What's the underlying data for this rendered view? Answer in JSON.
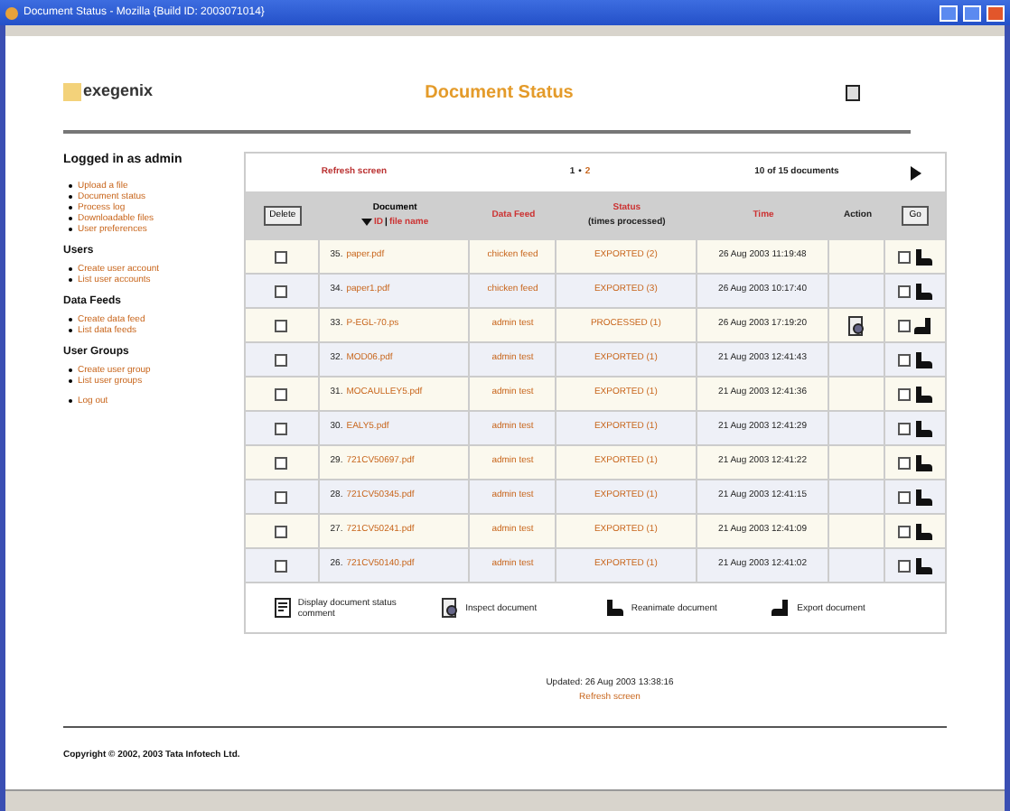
{
  "window": {
    "title": "Document Status - Mozilla {Build ID: 2003071014}"
  },
  "header": {
    "logo": "exegenix",
    "title": "Document Status"
  },
  "sidebar": {
    "heading": "Logged in as admin",
    "sections": [
      {
        "items": [
          "Upload a file",
          "Document status",
          "Process log",
          "Downloadable files",
          "User preferences"
        ]
      },
      {
        "title": "Users",
        "items": [
          "Create user account",
          "List user accounts"
        ]
      },
      {
        "title": "Data Feeds",
        "items": [
          "Create data feed",
          "List data feeds"
        ]
      },
      {
        "title": "User Groups",
        "items": [
          "Create user group",
          "List user groups"
        ]
      },
      {
        "items": [
          "Log out"
        ]
      }
    ]
  },
  "table": {
    "refresh": "Refresh screen",
    "pages": [
      {
        "label": "1",
        "selected": true
      },
      {
        "label": "2",
        "selected": false
      }
    ],
    "page_sep": "•",
    "count": "10 of 15 documents",
    "delete_button": "Delete",
    "go_button": "Go",
    "columns": {
      "document": "Document",
      "sort_id": "ID",
      "sort_sep": "|",
      "sort_file": "file name",
      "feed": "Data Feed",
      "status": "Status",
      "status_sub": "(times processed)",
      "time": "Time",
      "action": "Action"
    },
    "rows": [
      {
        "id": "35.",
        "file": "paper.pdf",
        "feed": "chicken feed",
        "status": "EXPORTED (2)",
        "time": "26 Aug 2003 11:19:48",
        "inspect": false,
        "kind": "reanimate",
        "checked": false,
        "checked2": false
      },
      {
        "id": "34.",
        "file": "paper1.pdf",
        "feed": "chicken feed",
        "status": "EXPORTED (3)",
        "time": "26 Aug 2003 10:17:40",
        "inspect": false,
        "kind": "reanimate",
        "checked": false,
        "checked2": false
      },
      {
        "id": "33.",
        "file": "P-EGL-70.ps",
        "feed": "admin test",
        "status": "PROCESSED (1)",
        "time": "26 Aug 2003 17:19:20",
        "inspect": true,
        "kind": "export",
        "checked": false,
        "checked2": false
      },
      {
        "id": "32.",
        "file": "MOD06.pdf",
        "feed": "admin test",
        "status": "EXPORTED (1)",
        "time": "21 Aug 2003 12:41:43",
        "inspect": false,
        "kind": "reanimate",
        "checked": false,
        "checked2": false
      },
      {
        "id": "31.",
        "file": "MOCAULLEY5.pdf",
        "feed": "admin test",
        "status": "EXPORTED (1)",
        "time": "21 Aug 2003 12:41:36",
        "inspect": false,
        "kind": "reanimate",
        "checked": false,
        "checked2": false
      },
      {
        "id": "30.",
        "file": "EALY5.pdf",
        "feed": "admin test",
        "status": "EXPORTED (1)",
        "time": "21 Aug 2003 12:41:29",
        "inspect": false,
        "kind": "reanimate",
        "checked": false,
        "checked2": false
      },
      {
        "id": "29.",
        "file": "721CV50697.pdf",
        "feed": "admin test",
        "status": "EXPORTED (1)",
        "time": "21 Aug 2003 12:41:22",
        "inspect": false,
        "kind": "reanimate",
        "checked": false,
        "checked2": false
      },
      {
        "id": "28.",
        "file": "721CV50345.pdf",
        "feed": "admin test",
        "status": "EXPORTED (1)",
        "time": "21 Aug 2003 12:41:15",
        "inspect": false,
        "kind": "reanimate",
        "checked": false,
        "checked2": false
      },
      {
        "id": "27.",
        "file": "721CV50241.pdf",
        "feed": "admin test",
        "status": "EXPORTED (1)",
        "time": "21 Aug 2003 12:41:09",
        "inspect": false,
        "kind": "reanimate",
        "checked": false,
        "checked2": false
      },
      {
        "id": "26.",
        "file": "721CV50140.pdf",
        "feed": "admin test",
        "status": "EXPORTED (1)",
        "time": "21 Aug 2003 12:41:02",
        "inspect": false,
        "kind": "reanimate",
        "checked": false,
        "checked2": false
      }
    ],
    "legend": [
      {
        "kind": "comment",
        "label": "Display document status comment"
      },
      {
        "kind": "inspect",
        "label": "Inspect document"
      },
      {
        "kind": "reanimate",
        "label": "Reanimate document"
      },
      {
        "kind": "export",
        "label": "Export document"
      }
    ]
  },
  "footer": {
    "updated": "Updated: 26 Aug 2003 13:38:16",
    "refresh": "Refresh screen",
    "copyright": "Copyright © 2002, 2003 Tata Infotech Ltd."
  }
}
